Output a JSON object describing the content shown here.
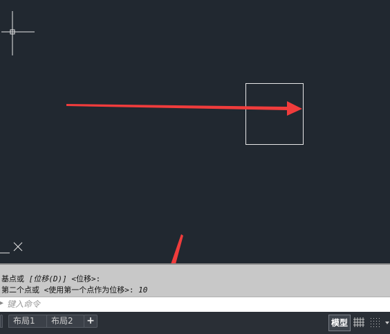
{
  "command_history": {
    "line1_a": "基点或 ",
    "line1_b": "[位移(D)]",
    "line1_c": " <位移>:",
    "line2_a": "第二个点或 <使用第一个点作为位移>:",
    "line2_value": " 10"
  },
  "command_input": {
    "placeholder": "键入命令"
  },
  "tabs": {
    "layout1": "布局1",
    "layout2": "布局2",
    "add": "+"
  },
  "status": {
    "model_label": "模型"
  },
  "colors": {
    "canvas_bg": "#212830",
    "annotation_arrow": "#f03c3c",
    "drawing_stroke": "#e8e8e8"
  },
  "icons": [
    "crosshair-cursor-icon",
    "ucs-icon",
    "grid-icon",
    "snap-icon",
    "dropdown-icon",
    "command-prompt-icon"
  ]
}
